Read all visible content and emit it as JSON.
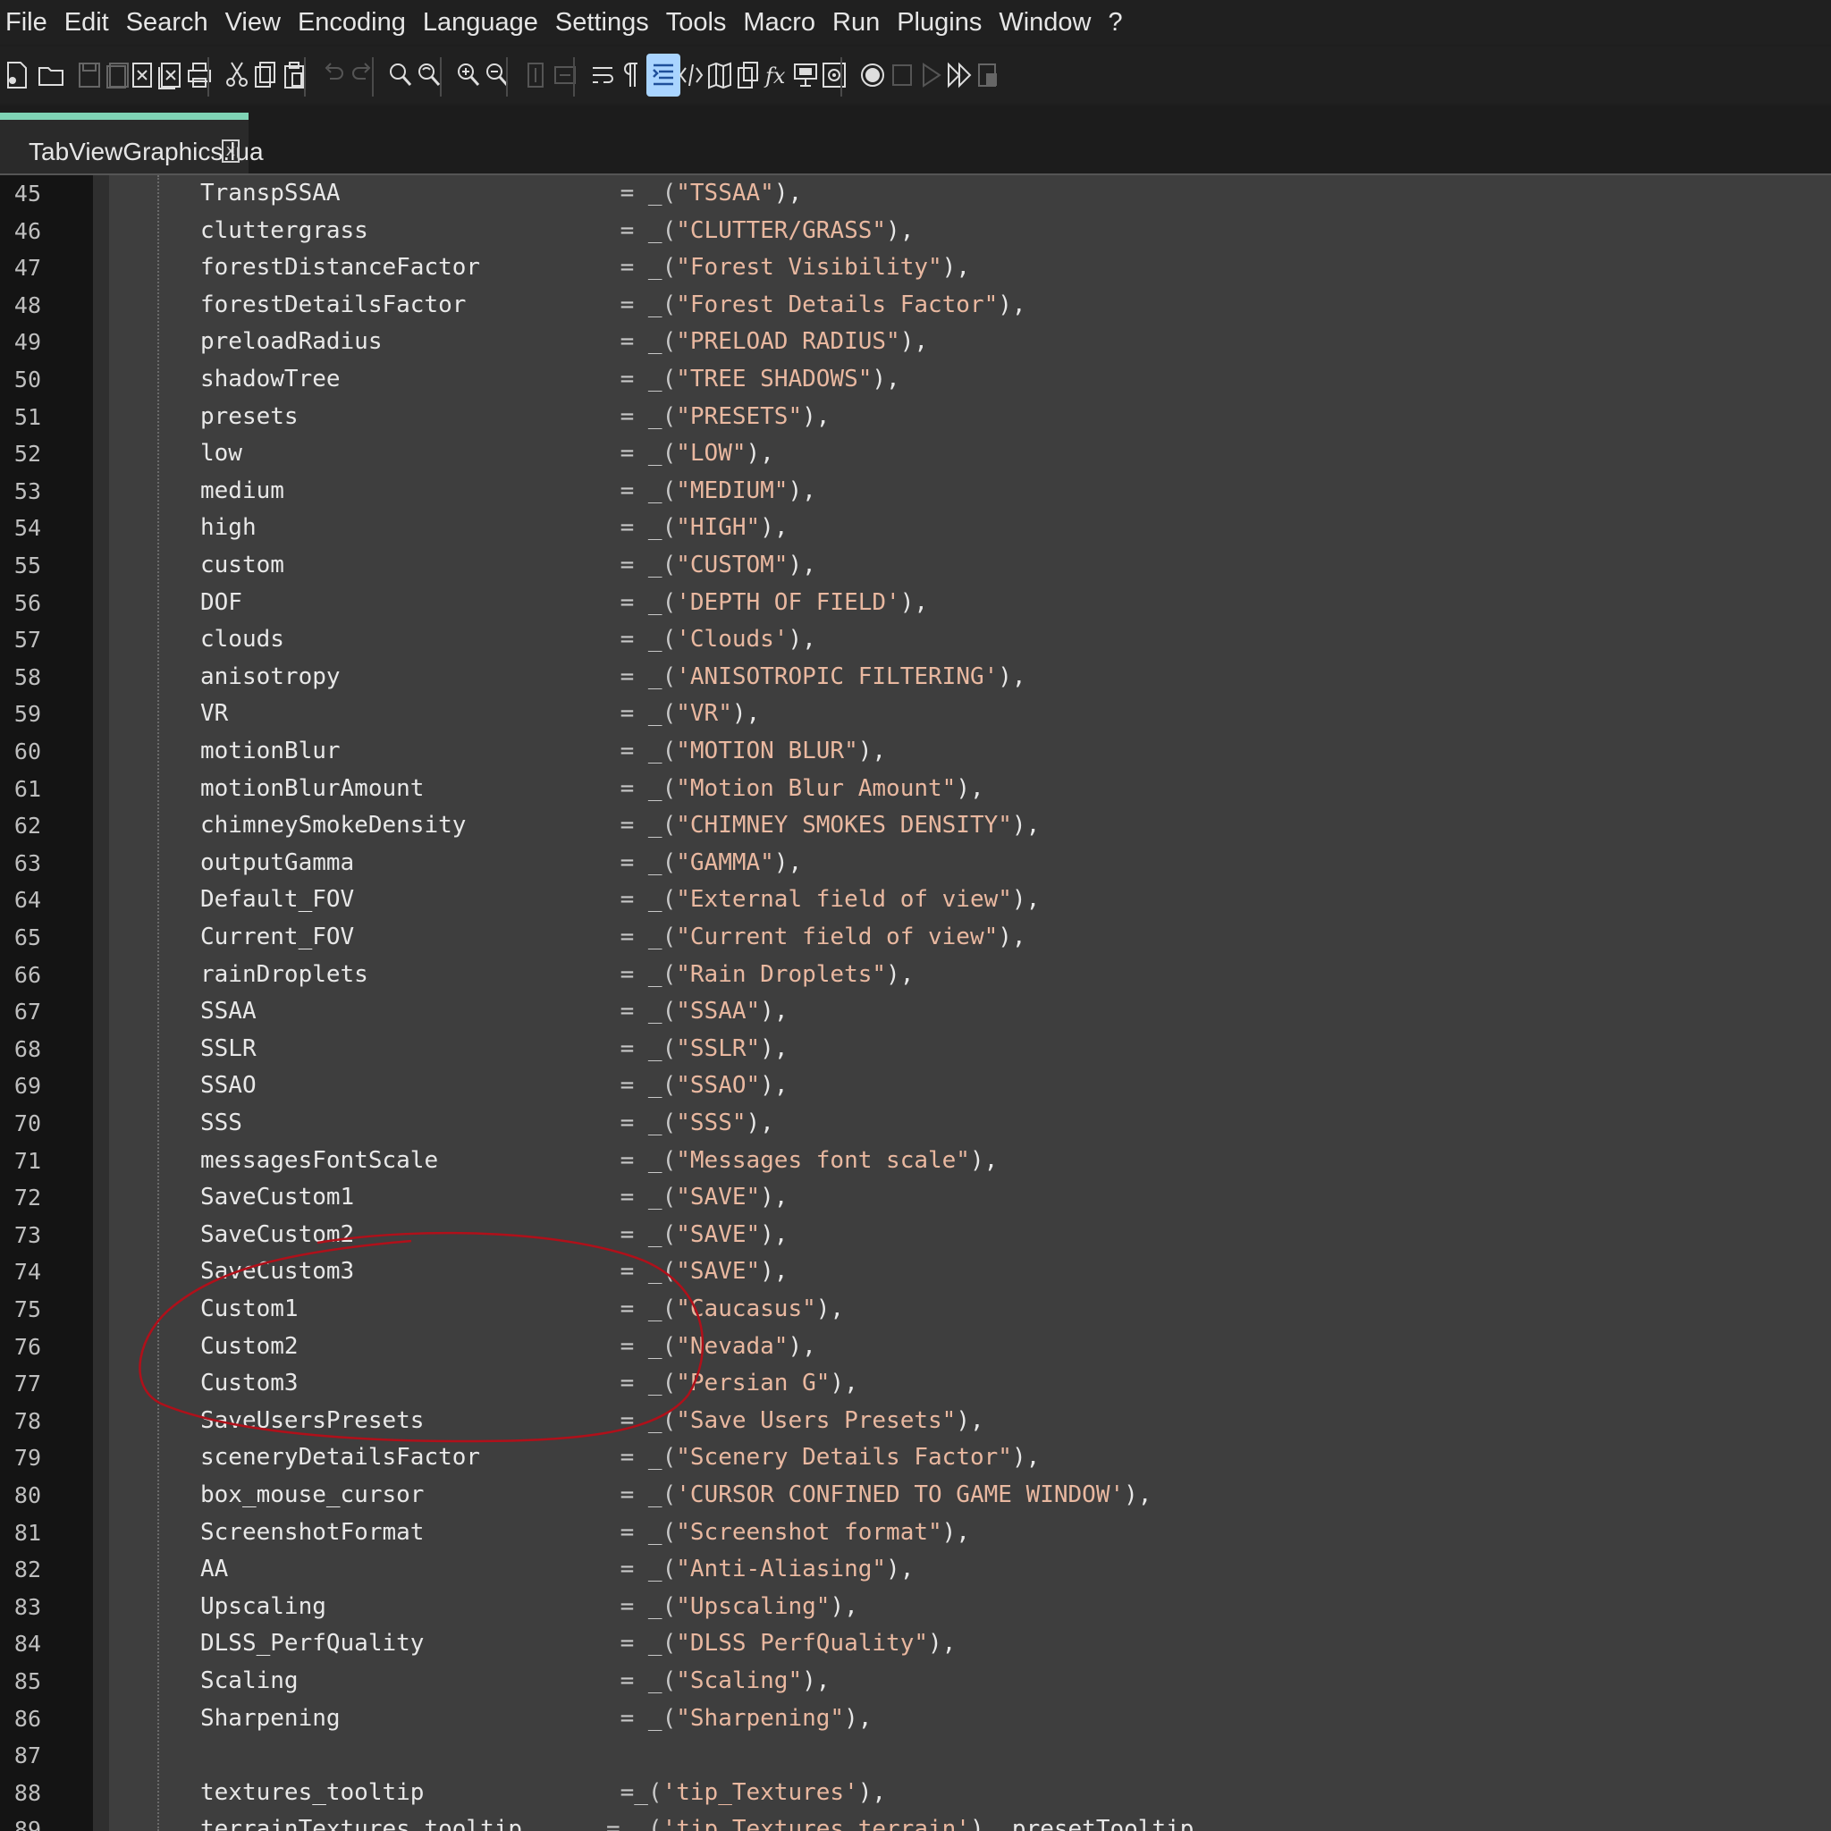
{
  "menu": [
    "File",
    "Edit",
    "Search",
    "View",
    "Encoding",
    "Language",
    "Settings",
    "Tools",
    "Macro",
    "Run",
    "Plugins",
    "Window",
    "?"
  ],
  "toolbar": {
    "icons": [
      {
        "name": "new-file-icon",
        "active": false
      },
      {
        "name": "open-file-icon",
        "active": false
      },
      {
        "name": "save-icon",
        "active": false
      },
      {
        "name": "save-all-icon",
        "active": false
      },
      {
        "name": "close-icon",
        "active": false
      },
      {
        "name": "close-all-icon",
        "active": false
      },
      {
        "name": "print-icon",
        "active": false
      },
      {
        "name": "cut-icon",
        "active": false
      },
      {
        "name": "copy-icon",
        "active": false
      },
      {
        "name": "paste-icon",
        "active": false
      },
      {
        "name": "undo-icon",
        "active": false
      },
      {
        "name": "redo-icon",
        "active": false
      },
      {
        "name": "find-icon",
        "active": false
      },
      {
        "name": "replace-icon",
        "active": false
      },
      {
        "name": "zoom-in-icon",
        "active": false
      },
      {
        "name": "zoom-out-icon",
        "active": false
      },
      {
        "name": "sync-vertical-icon",
        "active": false
      },
      {
        "name": "sync-horizontal-icon",
        "active": false
      },
      {
        "name": "word-wrap-icon",
        "active": false
      },
      {
        "name": "show-all-characters-icon",
        "active": false
      },
      {
        "name": "indent-guide-icon",
        "active": true
      },
      {
        "name": "language-xml-icon",
        "active": false
      },
      {
        "name": "document-map-icon",
        "active": false
      },
      {
        "name": "document-list-icon",
        "active": false
      },
      {
        "name": "function-list-icon",
        "active": false
      },
      {
        "name": "folder-as-workspace-icon",
        "active": false
      },
      {
        "name": "monitoring-icon",
        "active": false
      },
      {
        "name": "record-macro-icon",
        "active": false
      },
      {
        "name": "stop-recording-icon",
        "active": false
      },
      {
        "name": "play-macro-icon",
        "active": false
      },
      {
        "name": "run-macro-multiple-icon",
        "active": false
      },
      {
        "name": "save-macro-icon",
        "active": false
      }
    ]
  },
  "tab": {
    "title": "TabViewGraphics.lua",
    "close_glyph": "x"
  },
  "editor": {
    "lines": [
      {
        "num": "45",
        "key": "TranspSSAA",
        "op": "= _(",
        "str": "\"TSSAA\"",
        "end": "),"
      },
      {
        "num": "46",
        "key": "cluttergrass",
        "op": "= _(",
        "str": "\"CLUTTER/GRASS\"",
        "end": "),"
      },
      {
        "num": "47",
        "key": "forestDistanceFactor",
        "op": "= _(",
        "str": "\"Forest Visibility\"",
        "end": "),"
      },
      {
        "num": "48",
        "key": "forestDetailsFactor",
        "op": "= _(",
        "str": "\"Forest Details Factor\"",
        "end": "),"
      },
      {
        "num": "49",
        "key": "preloadRadius",
        "op": "= _(",
        "str": "\"PRELOAD RADIUS\"",
        "end": "),"
      },
      {
        "num": "50",
        "key": "shadowTree",
        "op": "= _(",
        "str": "\"TREE SHADOWS\"",
        "end": "),"
      },
      {
        "num": "51",
        "key": "presets",
        "op": "= _(",
        "str": "\"PRESETS\"",
        "end": "),"
      },
      {
        "num": "52",
        "key": "low",
        "op": "= _(",
        "str": "\"LOW\"",
        "end": "),"
      },
      {
        "num": "53",
        "key": "medium",
        "op": "= _(",
        "str": "\"MEDIUM\"",
        "end": "),"
      },
      {
        "num": "54",
        "key": "high",
        "op": "= _(",
        "str": "\"HIGH\"",
        "end": "),"
      },
      {
        "num": "55",
        "key": "custom",
        "op": "= _(",
        "str": "\"CUSTOM\"",
        "end": "),"
      },
      {
        "num": "56",
        "key": "DOF",
        "op": "= _(",
        "str": "'DEPTH OF FIELD'",
        "end": "),"
      },
      {
        "num": "57",
        "key": "clouds",
        "op": "= _(",
        "str": "'Clouds'",
        "end": "),"
      },
      {
        "num": "58",
        "key": "anisotropy",
        "op": "= _(",
        "str": "'ANISOTROPIC FILTERING'",
        "end": "),"
      },
      {
        "num": "59",
        "key": "VR",
        "op": "= _(",
        "str": "\"VR\"",
        "end": "),"
      },
      {
        "num": "60",
        "key": "motionBlur",
        "op": "= _(",
        "str": "\"MOTION BLUR\"",
        "end": "),"
      },
      {
        "num": "61",
        "key": "motionBlurAmount",
        "op": "= _(",
        "str": "\"Motion Blur Amount\"",
        "end": "),"
      },
      {
        "num": "62",
        "key": "chimneySmokeDensity",
        "op": "= _(",
        "str": "\"CHIMNEY SMOKES DENSITY\"",
        "end": "),"
      },
      {
        "num": "63",
        "key": "outputGamma",
        "op": "= _(",
        "str": "\"GAMMA\"",
        "end": "),"
      },
      {
        "num": "64",
        "key": "Default_FOV",
        "op": "= _(",
        "str": "\"External field of view\"",
        "end": "),"
      },
      {
        "num": "65",
        "key": "Current_FOV",
        "op": "= _(",
        "str": "\"Current field of view\"",
        "end": "),"
      },
      {
        "num": "66",
        "key": "rainDroplets",
        "op": "= _(",
        "str": "\"Rain Droplets\"",
        "end": "),"
      },
      {
        "num": "67",
        "key": "SSAA",
        "op": "= _(",
        "str": "\"SSAA\"",
        "end": "),"
      },
      {
        "num": "68",
        "key": "SSLR",
        "op": "= _(",
        "str": "\"SSLR\"",
        "end": "),"
      },
      {
        "num": "69",
        "key": "SSAO",
        "op": "= _(",
        "str": "\"SSAO\"",
        "end": "),"
      },
      {
        "num": "70",
        "key": "SSS",
        "op": "= _(",
        "str": "\"SSS\"",
        "end": "),"
      },
      {
        "num": "71",
        "key": "messagesFontScale",
        "op": "= _(",
        "str": "\"Messages font scale\"",
        "end": "),"
      },
      {
        "num": "72",
        "key": "SaveCustom1",
        "op": "= _(",
        "str": "\"SAVE\"",
        "end": "),"
      },
      {
        "num": "73",
        "key": "SaveCustom2",
        "op": "= _(",
        "str": "\"SAVE\"",
        "end": "),"
      },
      {
        "num": "74",
        "key": "SaveCustom3",
        "op": "= _(",
        "str": "\"SAVE\"",
        "end": "),"
      },
      {
        "num": "75",
        "key": "Custom1",
        "op": "= _(",
        "str": "\"Caucasus\"",
        "end": "),"
      },
      {
        "num": "76",
        "key": "Custom2",
        "op": "= _(",
        "str": "\"Nevada\"",
        "end": "),"
      },
      {
        "num": "77",
        "key": "Custom3",
        "op": "= _(",
        "str": "\"Persian G\"",
        "end": "),"
      },
      {
        "num": "78",
        "key": "SaveUsersPresets",
        "op": "= _(",
        "str": "\"Save Users Presets\"",
        "end": "),"
      },
      {
        "num": "79",
        "key": "sceneryDetailsFactor",
        "op": "= _(",
        "str": "\"Scenery Details Factor\"",
        "end": "),"
      },
      {
        "num": "80",
        "key": "box_mouse_cursor",
        "op": "= _(",
        "str": "'CURSOR CONFINED TO GAME WINDOW'",
        "end": "),"
      },
      {
        "num": "81",
        "key": "ScreenshotFormat",
        "op": "= _(",
        "str": "\"Screenshot format\"",
        "end": "),"
      },
      {
        "num": "82",
        "key": "AA",
        "op": "= _(",
        "str": "\"Anti-Aliasing\"",
        "end": "),"
      },
      {
        "num": "83",
        "key": "Upscaling",
        "op": "= _(",
        "str": "\"Upscaling\"",
        "end": "),"
      },
      {
        "num": "84",
        "key": "DLSS_PerfQuality",
        "op": "= _(",
        "str": "\"DLSS PerfQuality\"",
        "end": "),"
      },
      {
        "num": "85",
        "key": "Scaling",
        "op": "= _(",
        "str": "\"Scaling\"",
        "end": "),"
      },
      {
        "num": "86",
        "key": "Sharpening",
        "op": "= _(",
        "str": "\"Sharpening\"",
        "end": "),"
      },
      {
        "num": "87",
        "key": "",
        "op": "",
        "str": "",
        "end": ""
      },
      {
        "num": "88",
        "key": "textures_tooltip",
        "op": "=_(",
        "str": "'tip_Textures'",
        "end": "),"
      },
      {
        "num": "89",
        "key": "terrainTextures_tooltip",
        "op": "= _(",
        "str": "'tip_Textures_terrain'",
        "end": "), presetTooltip"
      }
    ]
  },
  "colors": {
    "annotation": "#b0101a",
    "active_tab_accent": "#7fd3b5",
    "string": "#e9b8a0"
  }
}
